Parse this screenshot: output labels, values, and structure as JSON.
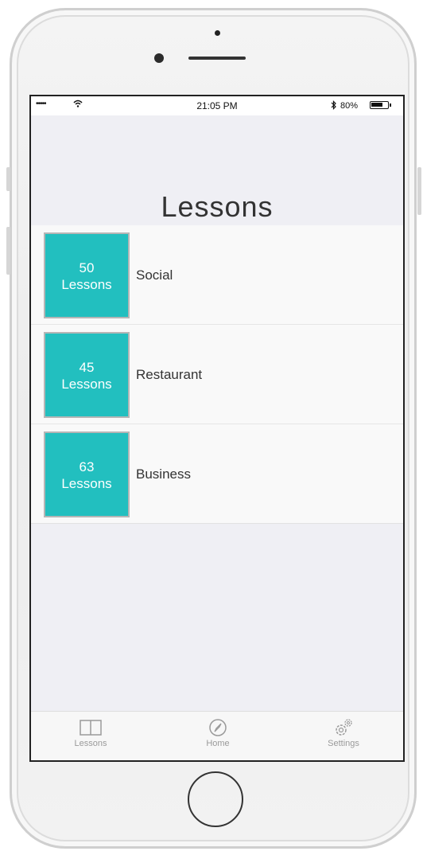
{
  "status_bar": {
    "signal": "•••••",
    "time": "21:05 PM",
    "battery_text": "80%",
    "battery_level": 0.8
  },
  "nav": {
    "title": "Lessons"
  },
  "lessons": [
    {
      "count": "50",
      "unit": "Lessons",
      "name": "Social"
    },
    {
      "count": "45",
      "unit": "Lessons",
      "name": "Restaurant"
    },
    {
      "count": "63",
      "unit": "Lessons",
      "name": "Business"
    }
  ],
  "tabs": [
    {
      "label": "Lessons",
      "icon": "book-icon"
    },
    {
      "label": "Home",
      "icon": "compass-icon"
    },
    {
      "label": "Settings",
      "icon": "gears-icon"
    }
  ],
  "colors": {
    "tile": "#22bfbf",
    "tab_inactive": "#9a9a9a",
    "screen_bg": "#efeff4"
  }
}
